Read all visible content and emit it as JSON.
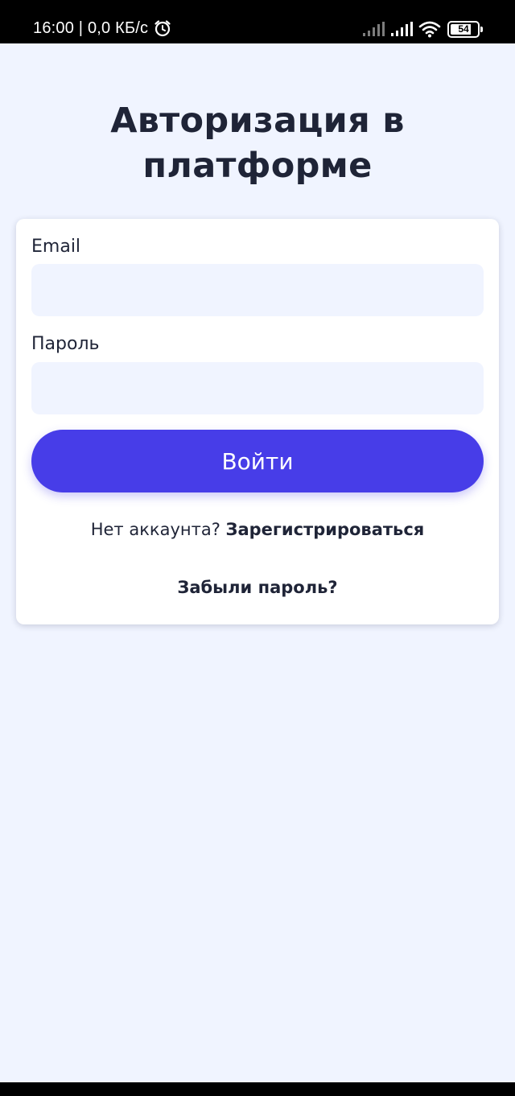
{
  "status_bar": {
    "time_and_speed": "16:00 | 0,0 КБ/с",
    "alarm_icon": "alarm-clock-icon",
    "signal_icons": [
      "signal-icon",
      "signal-icon"
    ],
    "wifi_icon": "wifi-icon",
    "battery_level": "54"
  },
  "page": {
    "title_line1": "Авторизация в",
    "title_line2": "платформе"
  },
  "form": {
    "email_label": "Email",
    "email_value": "",
    "password_label": "Пароль",
    "password_value": "",
    "login_button_label": "Войти",
    "no_account_text": "Нет аккаунта?",
    "register_link_label": "Зарегистрироваться",
    "forgot_password_label": "Забыли пароль?"
  },
  "colors": {
    "background": "#f0f4ff",
    "card": "#ffffff",
    "input_background": "#f0f4ff",
    "primary_button": "#473de8",
    "text": "#1f2437"
  }
}
